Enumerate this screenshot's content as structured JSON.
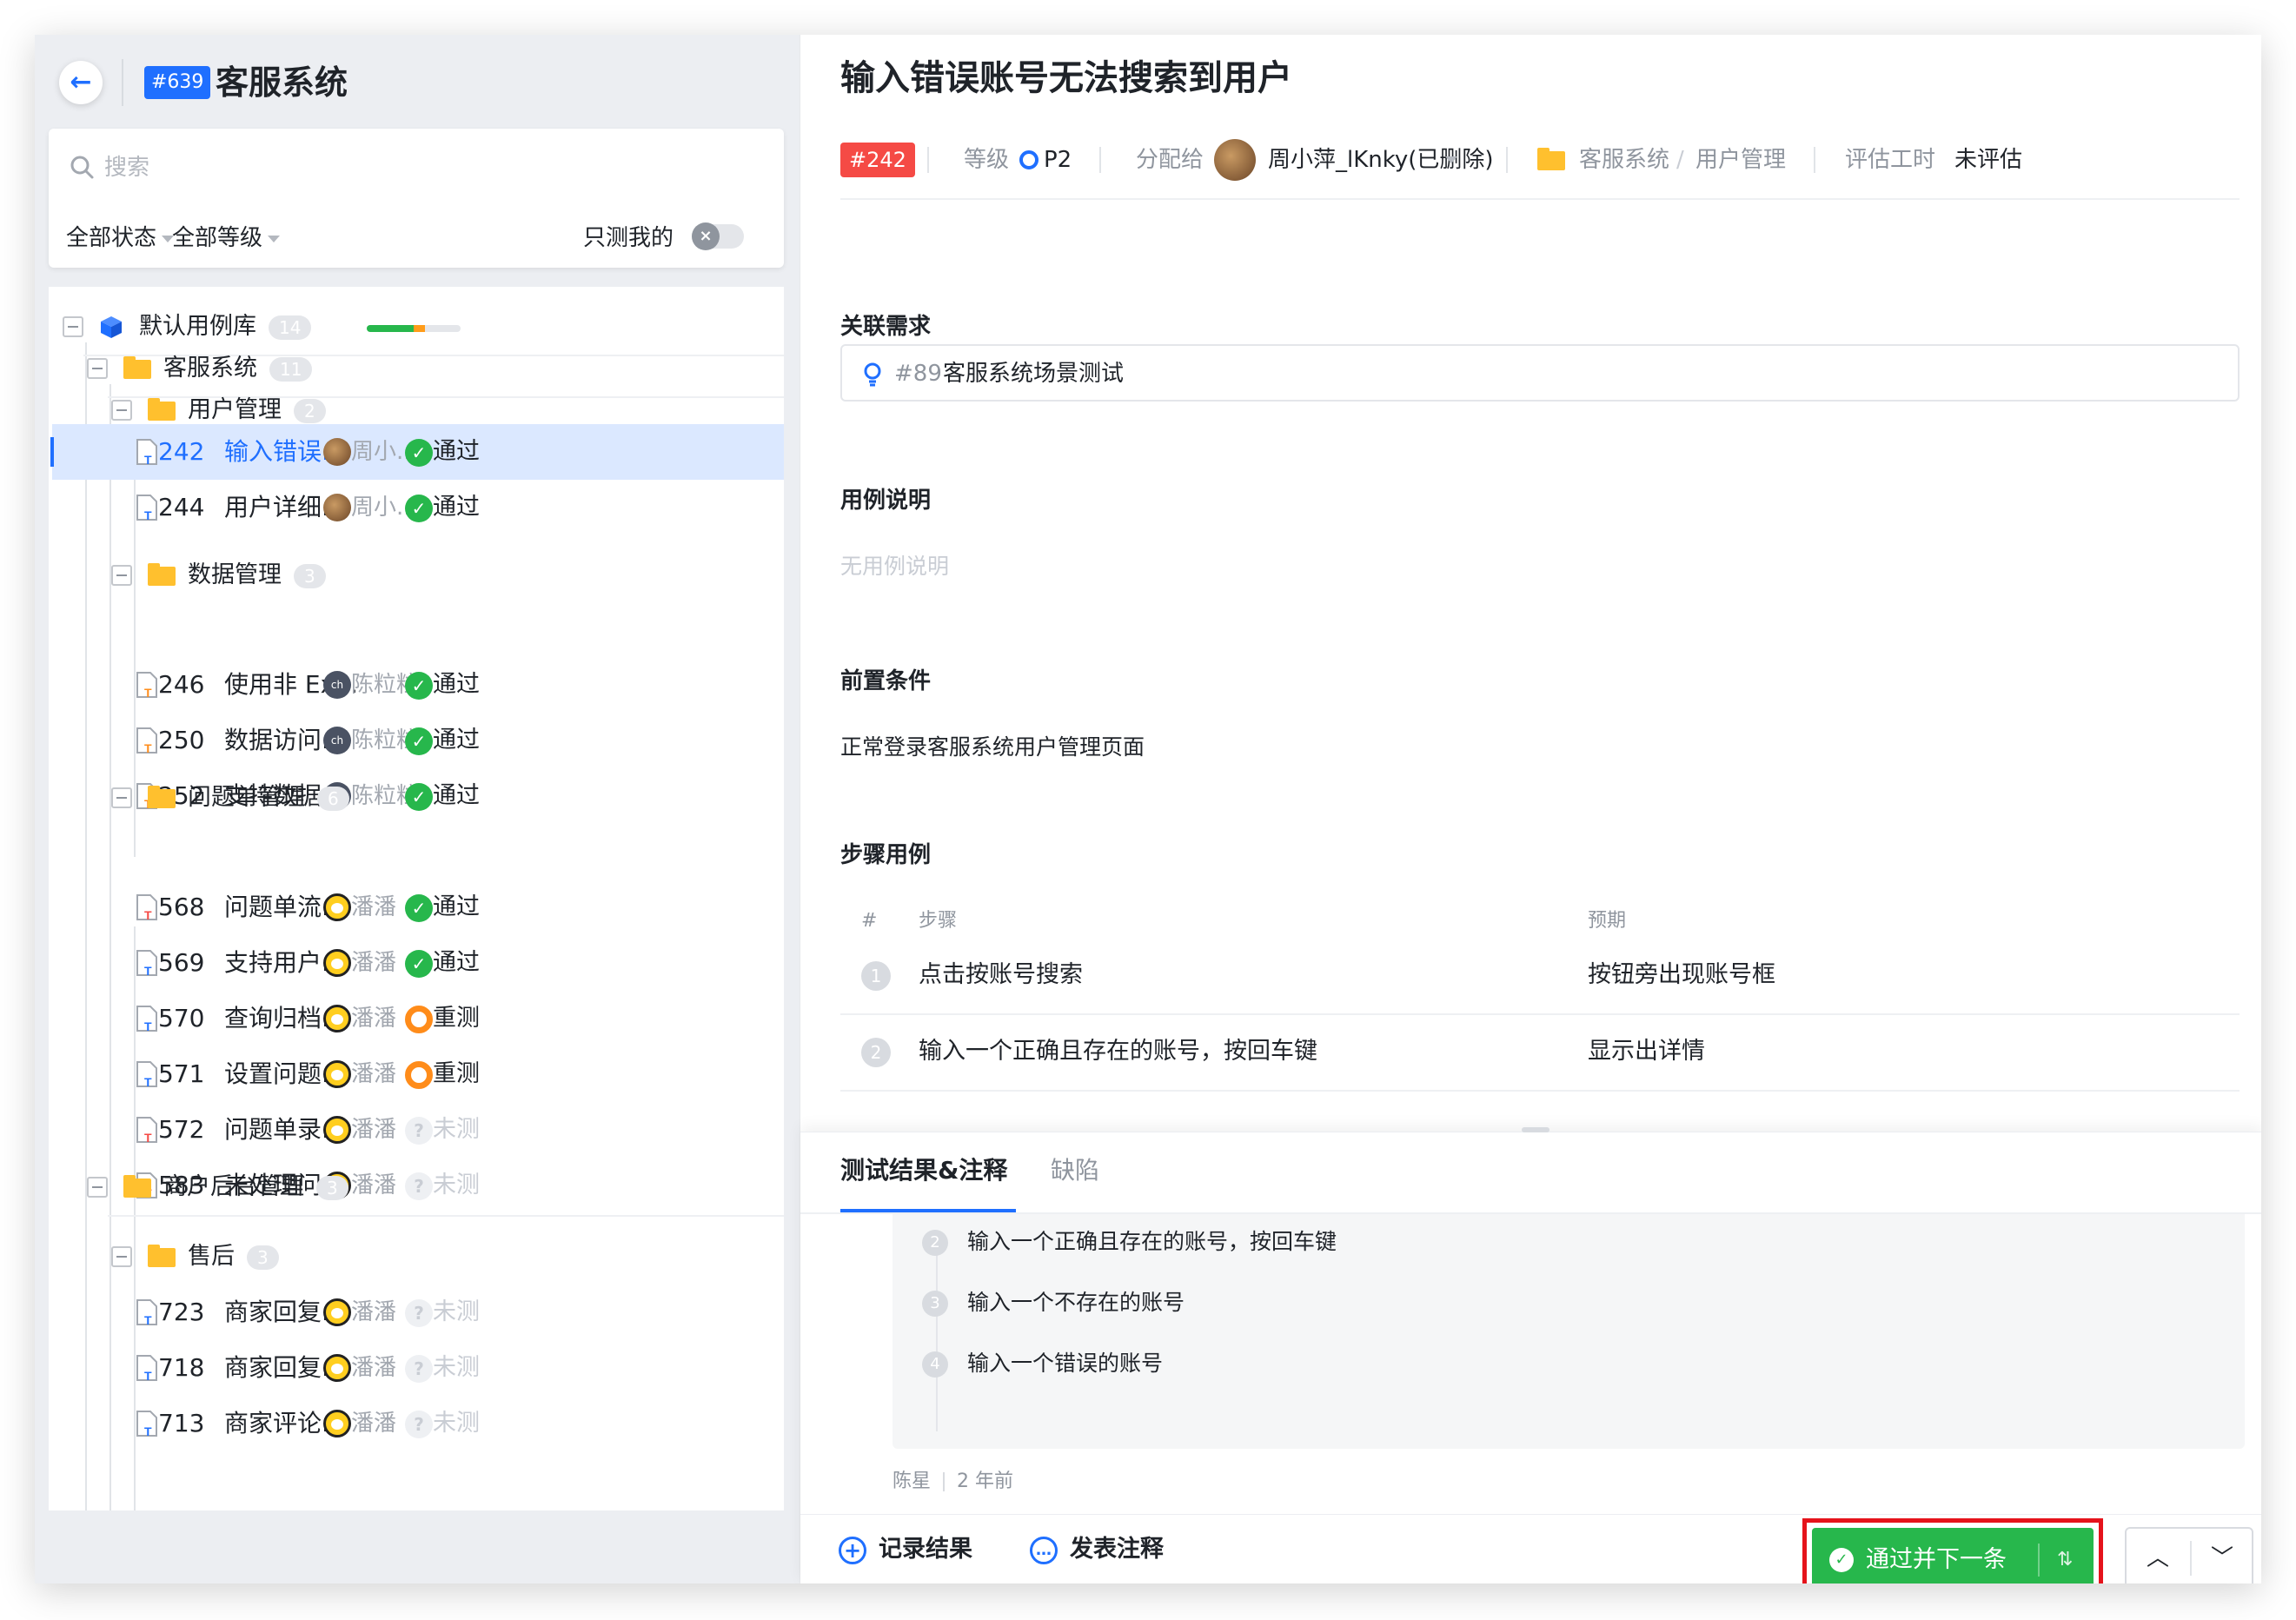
{
  "header": {
    "project_id": "#639",
    "project_name": "客服系统"
  },
  "search": {
    "placeholder": "搜索"
  },
  "filters": {
    "status": "全部状态",
    "level": "全部等级",
    "only_mine": "只测我的"
  },
  "tree": {
    "root": {
      "label": "默认用例库",
      "count": "14",
      "progress": {
        "pass": 0.5,
        "retest": 0.12,
        "untested": 0.38
      }
    },
    "groups": [
      {
        "label": "客服系统",
        "count": "11"
      },
      {
        "label": "用户管理",
        "count": "2"
      },
      {
        "label": "数据管理",
        "count": "3"
      },
      {
        "label": "问题单管理",
        "count": "6"
      },
      {
        "label": "商户后台管理",
        "count": "3"
      },
      {
        "label": "售后",
        "count": "3"
      }
    ],
    "cases": [
      {
        "id": "242",
        "title": "输入错误...",
        "assignee": "周小...",
        "status": "通过"
      },
      {
        "id": "244",
        "title": "用户详细...",
        "assignee": "周小...",
        "status": "通过"
      },
      {
        "id": "246",
        "title": "使用非 Ex...",
        "assignee": "陈粒粒",
        "status": "通过"
      },
      {
        "id": "250",
        "title": "数据访问...",
        "assignee": "陈粒粒",
        "status": "通过"
      },
      {
        "id": "252",
        "title": "支持数据...",
        "assignee": "陈粒粒",
        "status": "通过"
      },
      {
        "id": "568",
        "title": "问题单流...",
        "assignee": "潘潘",
        "status": "通过"
      },
      {
        "id": "569",
        "title": "支持用户...",
        "assignee": "潘潘",
        "status": "通过"
      },
      {
        "id": "570",
        "title": "查询归档...",
        "assignee": "潘潘",
        "status": "重测"
      },
      {
        "id": "571",
        "title": "设置问题...",
        "assignee": "潘潘",
        "status": "重测"
      },
      {
        "id": "572",
        "title": "问题单录...",
        "assignee": "潘潘",
        "status": "未测"
      },
      {
        "id": "583",
        "title": "未处理问...",
        "assignee": "潘潘",
        "status": "未测"
      },
      {
        "id": "723",
        "title": "商家回复...",
        "assignee": "潘潘",
        "status": "未测"
      },
      {
        "id": "718",
        "title": "商家回复...",
        "assignee": "潘潘",
        "status": "未测"
      },
      {
        "id": "713",
        "title": "商家评论...",
        "assignee": "潘潘",
        "status": "未测"
      }
    ],
    "avatar_initials": "ch"
  },
  "case": {
    "title": "输入错误账号无法搜索到用户",
    "badge": "#242",
    "level_label": "等级",
    "level": "P2",
    "assign_label": "分配给",
    "assignee": "周小萍_lKnky(已删除)",
    "path_1": "客服系统",
    "path_sep": "/",
    "path_2": "用户管理",
    "estimate_label": "评估工时",
    "estimate": "未评估"
  },
  "sections": {
    "requirement": "关联需求",
    "description": "用例说明",
    "precondition": "前置条件",
    "steps": "步骤用例"
  },
  "requirement": {
    "id": "#89",
    "name": "客服系统场景测试"
  },
  "description_empty": "无用例说明",
  "precondition_text": "正常登录客服系统用户管理页面",
  "steps_table": {
    "col_num": "#",
    "col_step": "步骤",
    "col_expect": "预期",
    "rows": [
      {
        "n": "1",
        "step": "点击按账号搜索",
        "expect": "按钮旁出现账号框"
      },
      {
        "n": "2",
        "step": "输入一个正确且存在的账号，按回车键",
        "expect": "显示出详情"
      }
    ]
  },
  "tabs": {
    "result": "测试结果&注释",
    "bugs": "缺陷"
  },
  "result_steps": [
    {
      "n": "2",
      "text": "输入一个正确且存在的账号，按回车键"
    },
    {
      "n": "3",
      "text": "输入一个不存在的账号"
    },
    {
      "n": "4",
      "text": "输入一个错误的账号"
    }
  ],
  "result_meta": {
    "author": "陈星",
    "time": "2 年前"
  },
  "footer": {
    "record": "记录结果",
    "comment": "发表注释",
    "pass_next": "通过并下一条"
  },
  "colors": {
    "primary": "#1f6fff",
    "pass": "#27b74c",
    "retest": "#ff8c1a",
    "danger": "#f54a45"
  }
}
